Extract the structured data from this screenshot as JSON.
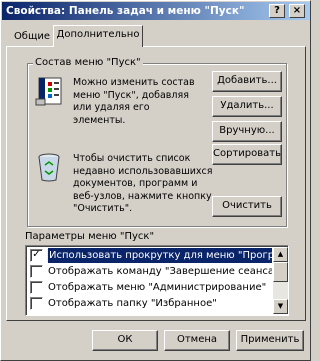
{
  "window": {
    "title": "Свойства: Панель задач и меню \"Пуск\"",
    "help_button": "?",
    "close_button": "×"
  },
  "tabs": [
    {
      "label": "Общие",
      "active": false
    },
    {
      "label": "Дополнительно",
      "active": true
    }
  ],
  "start_menu_group": {
    "label": "Состав меню \"Пуск\"",
    "description": "Можно изменить состав\nменю \"Пуск\", добавляя\nили удаляя его элементы.",
    "buttons": {
      "add": "Добавить...",
      "remove": "Удалить...",
      "manual": "Вручную...",
      "sort": "Сортировать"
    },
    "clear_description": "Чтобы очистить список\nнедавно использовавшихся\nдокументов, программ и\nвеб-узлов, нажмите кнопку\n\"Очистить\".",
    "clear_button": "Очистить"
  },
  "options": {
    "label": "Параметры меню \"Пуск\"",
    "items": [
      {
        "text": "Использовать прокрутку для меню \"Программы\"",
        "checked": true,
        "selected": true
      },
      {
        "text": "Отображать команду \"Завершение сеанса\"",
        "checked": false,
        "selected": false
      },
      {
        "text": "Отображать меню \"Администрирование\"",
        "checked": false,
        "selected": false
      },
      {
        "text": "Отображать папку \"Избранное\"",
        "checked": false,
        "selected": false
      }
    ],
    "scroll_up": "▲",
    "scroll_down": "▼"
  },
  "footer": {
    "ok": "ОК",
    "cancel": "Отмена",
    "apply": "Применить"
  },
  "colors": {
    "title_start": "#0a246a",
    "title_end": "#a6caf0",
    "face": "#d4d0c8",
    "selection": "#0a246a"
  }
}
